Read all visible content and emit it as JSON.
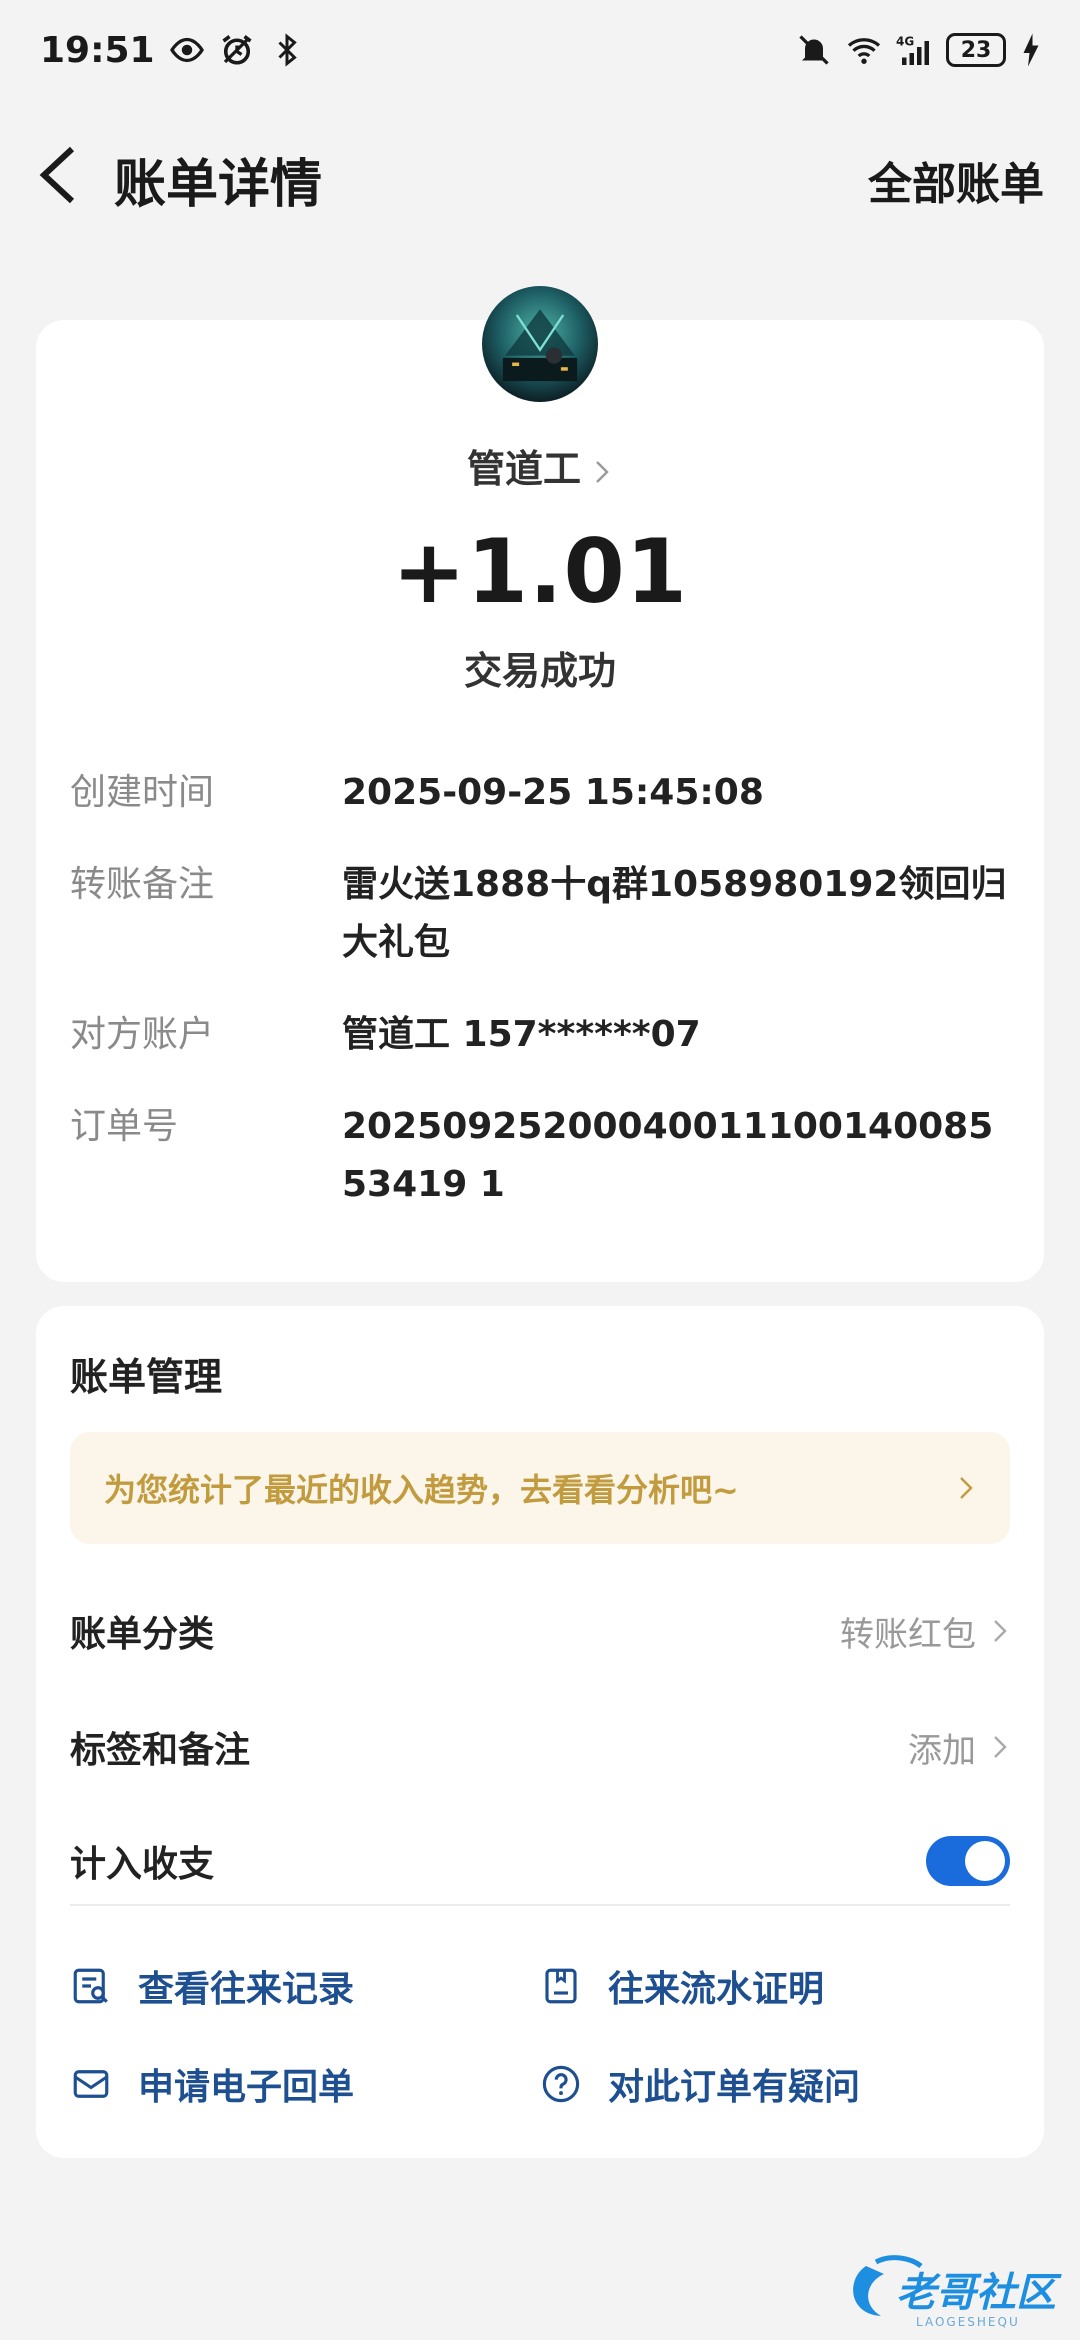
{
  "status_bar": {
    "time": "19:51",
    "battery": "23",
    "icons": [
      "eye-icon",
      "alarm-icon",
      "bluetooth-icon",
      "mute-icon",
      "wifi-icon",
      "signal-4g-icon",
      "charging-icon"
    ]
  },
  "header": {
    "title": "账单详情",
    "right_link": "全部账单"
  },
  "transaction": {
    "payee": "管道工",
    "amount": "+1.01",
    "status": "交易成功",
    "details": [
      {
        "label": "创建时间",
        "value": "2025-09-25 15:45:08"
      },
      {
        "label": "转账备注",
        "value": "雷火送1888十q群1058980192领回归大礼包"
      },
      {
        "label": "对方账户",
        "value": "管道工 157******07"
      },
      {
        "label": "订单号",
        "value": "2025092520004001110014008553419 1"
      }
    ]
  },
  "manage": {
    "title": "账单管理",
    "insight": "为您统计了最近的收入趋势，去看看分析吧~",
    "category_label": "账单分类",
    "category_value": "转账红包",
    "tag_label": "标签和备注",
    "tag_value": "添加",
    "count_label": "计入收支",
    "count_enabled": true,
    "links": {
      "history": "查看往来记录",
      "proof": "往来流水证明",
      "receipt": "申请电子回单",
      "question": "对此订单有疑问"
    }
  },
  "colors": {
    "accent": "#1a6bdc",
    "link": "#1d4f91",
    "insight_text": "#c19b3e",
    "insight_bg": "#fbf5ea"
  },
  "watermark": {
    "text": "老哥社区",
    "subtext": "LAOGESHEQU"
  }
}
